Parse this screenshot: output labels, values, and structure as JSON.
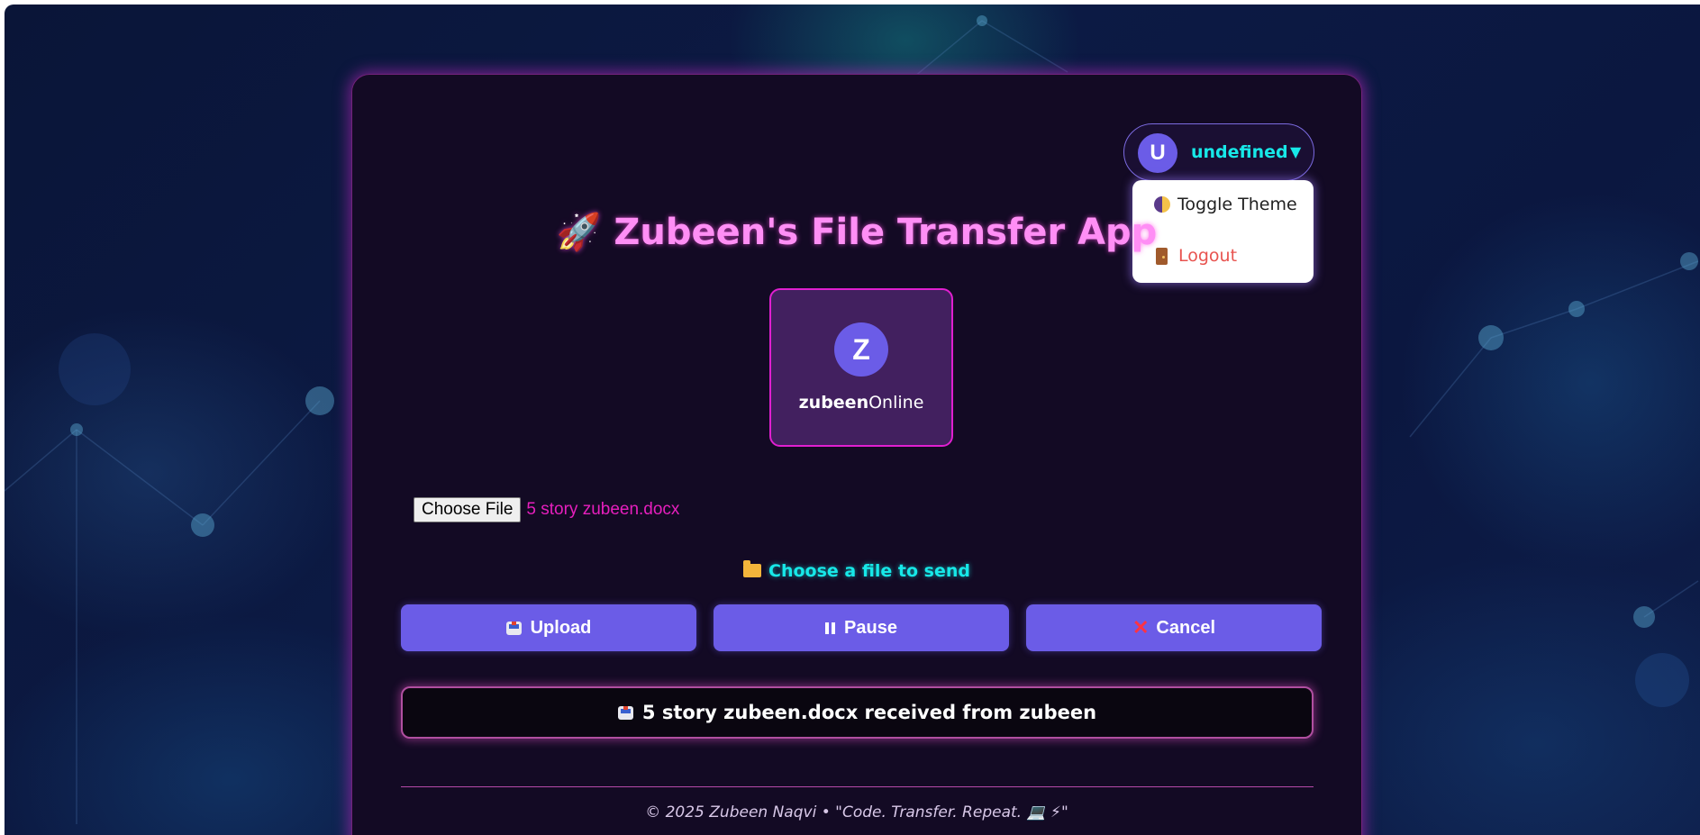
{
  "app": {
    "title_icon": "rocket-icon",
    "title": "🚀 Zubeen's File Transfer App"
  },
  "account": {
    "avatar_letter": "U",
    "username": "undefined",
    "caret": "▼",
    "menu": {
      "toggle_theme": "Toggle Theme",
      "logout": "Logout"
    }
  },
  "peer": {
    "avatar_letter": "Z",
    "name": "zubeen",
    "status": "Online"
  },
  "file_input": {
    "button_label": "Choose File",
    "file_name": "5 story zubeen.docx"
  },
  "status_message": "Choose a file to send",
  "actions": {
    "upload": "Upload",
    "pause": "Pause",
    "cancel": "Cancel"
  },
  "received_message": "5 story zubeen.docx received from zubeen",
  "footer": "© 2025 Zubeen Naqvi • \"Code. Transfer. Repeat. 💻 ⚡\"",
  "colors": {
    "accent": "#6b5ce7",
    "title_pink": "#ff8ef5",
    "cyan": "#17e8e8",
    "file_name_pink": "#e61fbd",
    "logout_red": "#e8534f",
    "card_bg": "#130a24"
  }
}
